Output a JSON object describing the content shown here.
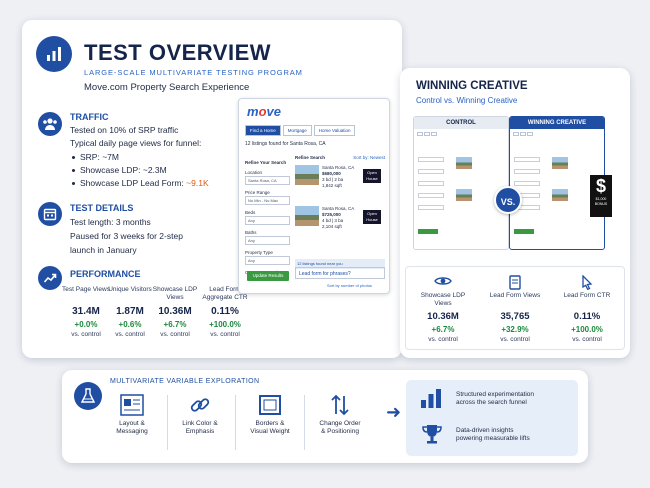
{
  "overview": {
    "title": "TEST OVERVIEW",
    "subtitle": "LARGE-SCALE MULTIVARIATE TESTING PROGRAM",
    "site": "Move.com Property Search Experience"
  },
  "traffic": {
    "heading": "TRAFFIC",
    "line1": "Tested on 10% of SRP traffic",
    "line2": "Typical daily page views for funnel:",
    "bullets": [
      {
        "label": "SRP:",
        "value": "~7M"
      },
      {
        "label": "Showcase LDP:",
        "value": "~2.3M"
      },
      {
        "label": "Showcase LDP Lead Form:",
        "value": "~9.1K"
      }
    ]
  },
  "details": {
    "heading": "TEST DETAILS",
    "line1": "Test length: 3 months",
    "line2": "Paused for 3 weeks for 2-step",
    "line3": "launch in January"
  },
  "performance": {
    "heading": "PERFORMANCE",
    "metrics": [
      {
        "label": "Test Page Views",
        "value": "31.4M",
        "change": "+0.0%",
        "vs": "vs. control"
      },
      {
        "label": "Unique Visitors",
        "value": "1.87M",
        "change": "+0.6%",
        "vs": "vs. control"
      },
      {
        "label": "Showcase LDP Views",
        "value": "10.36M",
        "change": "+6.7%",
        "vs": "vs. control"
      },
      {
        "label": "Lead Form Aggregate CTR",
        "value": "0.11%",
        "change": "+100.0%",
        "vs": "vs. control"
      }
    ]
  },
  "mockup": {
    "logo_main": "m",
    "logo_o": "o",
    "logo_rest": "ve",
    "tabs": [
      "Find a Home",
      "Mortgage",
      "Home Valuation"
    ],
    "count": "12 listings found for Santa Rosa, CA",
    "side_title": "Refine Your Search",
    "fields": [
      {
        "label": "Location",
        "value": "Santa Rosa, CA"
      },
      {
        "label": "Price Range",
        "value": "No Min - No Max"
      },
      {
        "label": "Beds",
        "value": "Any"
      },
      {
        "label": "Baths",
        "value": "Any"
      },
      {
        "label": "Property Type",
        "value": "Any"
      }
    ],
    "open_house_check": "Open House only",
    "update_btn": "Update Results",
    "list_head": "Refine Search",
    "sort": "Sort by: Newest",
    "listings": [
      {
        "city": "Santa Rosa, CA",
        "price": "$680,000",
        "beds": "3 bd | 2 ba",
        "sqft": "1,842 sqft",
        "badge": "Open House"
      },
      {
        "city": "Santa Rosa, CA",
        "price": "$725,000",
        "beds": "4 bd | 3 ba",
        "sqft": "2,104 sqft",
        "badge": "Open House"
      }
    ],
    "banner": "12 listings found near you",
    "lead_form": "Lead form for phrases?",
    "more": "Sort by number of photos"
  },
  "winning": {
    "title": "WINNING CREATIVE",
    "subtitle": "Control vs. Winning Creative",
    "control_label": "CONTROL",
    "winner_label": "WINNING CREATIVE",
    "vs": "VS.",
    "money_sign": "$",
    "money_text": "$1,000 BONUS",
    "metrics": [
      {
        "label": "Showcase LDP Views",
        "value": "10.36M",
        "change": "+6.7%",
        "vs": "vs. control"
      },
      {
        "label": "Lead Form Views",
        "value": "35,765",
        "change": "+32.9%",
        "vs": "vs. control"
      },
      {
        "label": "Lead Form CTR",
        "value": "0.11%",
        "change": "+100.0%",
        "vs": "vs. control"
      }
    ]
  },
  "exploration": {
    "title": "MULTIVARIATE VARIABLE EXPLORATION",
    "variables": [
      {
        "label1": "Layout &",
        "label2": "Messaging"
      },
      {
        "label1": "Link Color &",
        "label2": "Emphasis"
      },
      {
        "label1": "Borders &",
        "label2": "Visual Weight"
      },
      {
        "label1": "Change Order",
        "label2": "& Positioning"
      }
    ],
    "results": [
      {
        "line1": "Structured experimentation",
        "line2": "across the search funnel"
      },
      {
        "line1": "Data-driven insights",
        "line2": "powering measurable lifts"
      }
    ]
  },
  "colors": {
    "accent": "#1f4ea3",
    "positive": "#1a8a3c",
    "highlight": "#e05a14"
  }
}
